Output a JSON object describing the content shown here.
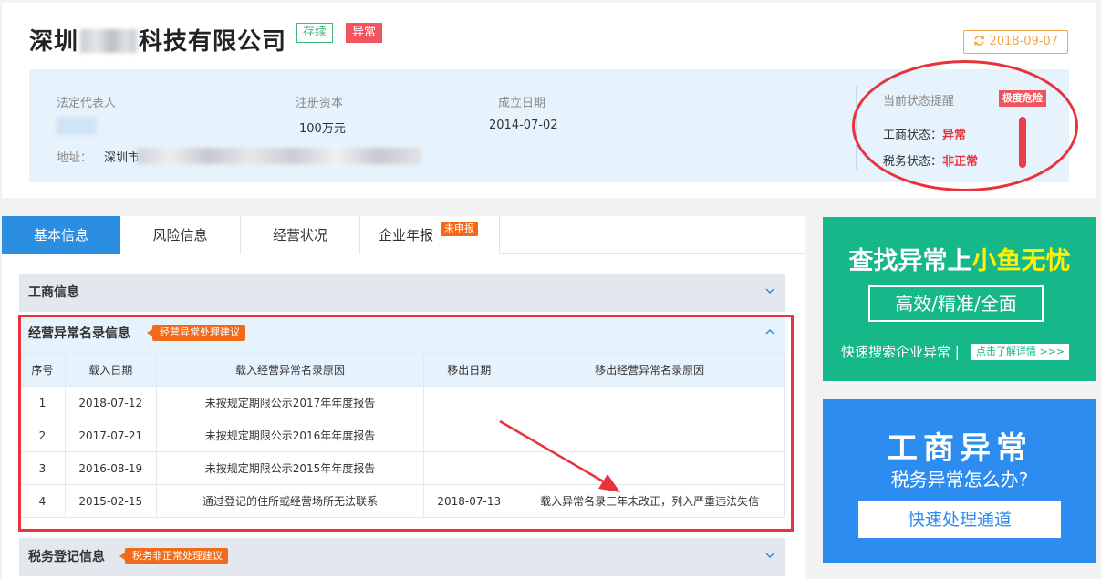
{
  "header": {
    "company_name_prefix": "深圳",
    "company_name_suffix": "科技有限公司",
    "tag_status": "存续",
    "tag_abnormal": "异常",
    "update_date": "2018-09-07"
  },
  "info": {
    "legal_rep_label": "法定代表人",
    "capital_label": "注册资本",
    "capital_value": "100万元",
    "founded_label": "成立日期",
    "founded_value": "2014-07-02",
    "address_label": "地址：",
    "address_value": "深圳市"
  },
  "status": {
    "title": "当前状态提醒",
    "danger_badge": "极度危险",
    "business_label": "工商状态：",
    "business_value": "异常",
    "tax_label": "税务状态：",
    "tax_value": "非正常"
  },
  "tabs": [
    {
      "label": "基本信息"
    },
    {
      "label": "风险信息"
    },
    {
      "label": "经营状况"
    },
    {
      "label": "企业年报",
      "badge": "未申报"
    }
  ],
  "sections": {
    "business_info": "工商信息",
    "abnormal_list": "经营异常名录信息",
    "abnormal_badge": "经营异常处理建议",
    "tax_info": "税务登记信息",
    "tax_badge": "税务非正常处理建议"
  },
  "table": {
    "headers": [
      "序号",
      "载入日期",
      "载入经营异常名录原因",
      "移出日期",
      "移出经营异常名录原因"
    ],
    "rows": [
      [
        "1",
        "2018-07-12",
        "未按规定期限公示2017年年度报告",
        "",
        ""
      ],
      [
        "2",
        "2017-07-21",
        "未按规定期限公示2016年年度报告",
        "",
        ""
      ],
      [
        "3",
        "2016-08-19",
        "未按规定期限公示2015年年度报告",
        "",
        ""
      ],
      [
        "4",
        "2015-02-15",
        "通过登记的住所或经营场所无法联系",
        "2018-07-13",
        "载入异常名录三年未改正，列入严重违法失信"
      ]
    ]
  },
  "ad_green": {
    "title_white": "查找异常上",
    "title_yellow": "小鱼无忧",
    "button": "高效/精准/全面",
    "footer": "快速搜索企业异常 |",
    "link": "点击了解详情 >>>"
  },
  "ad_blue": {
    "title": "工商异常",
    "subtitle": "税务异常怎么办?",
    "button": "快速处理通道"
  },
  "colors": {
    "accent_blue": "#2b8ee0",
    "danger_red": "#e8323c",
    "ad_green": "#16b788",
    "ad_blue": "#2d8cf0"
  }
}
